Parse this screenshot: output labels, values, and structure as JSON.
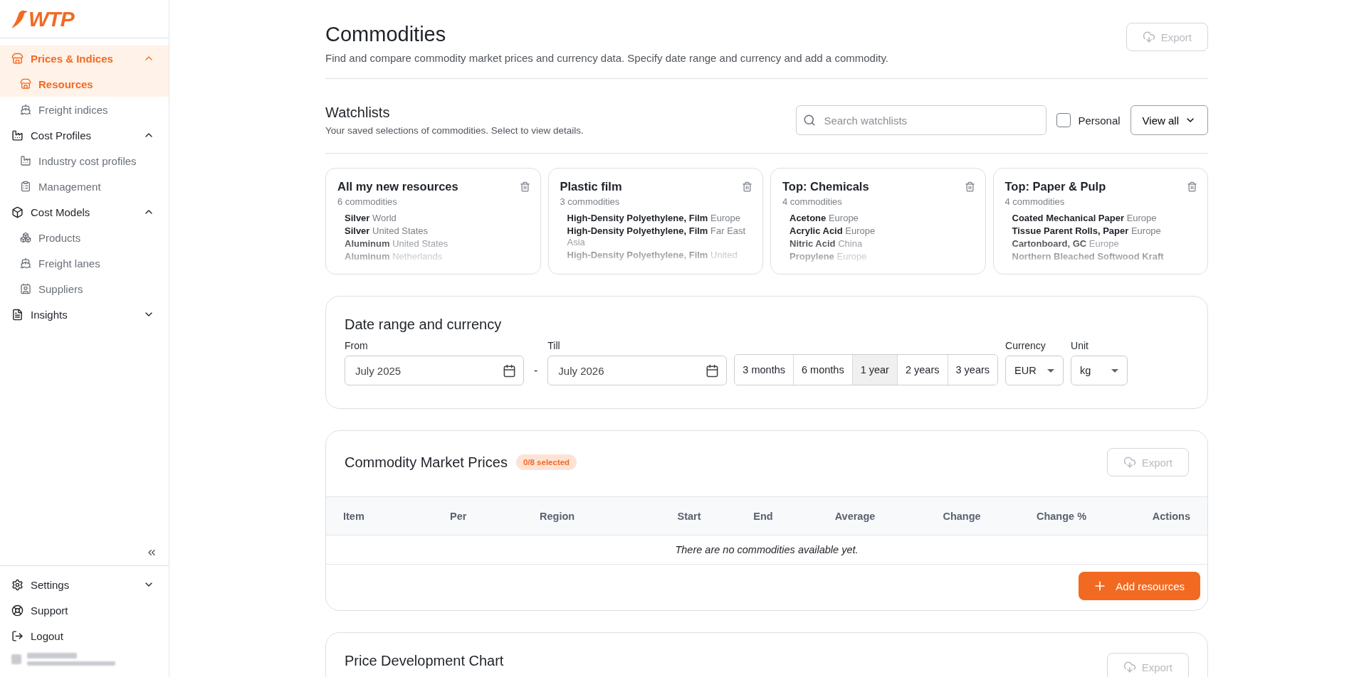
{
  "logo": {
    "text": "WTP"
  },
  "sidebar": {
    "groups": [
      {
        "label": "Prices & Indices",
        "selected": true,
        "expanded": true,
        "children": [
          {
            "label": "Resources",
            "selected": true
          },
          {
            "label": "Freight indices",
            "selected": false
          }
        ]
      },
      {
        "label": "Cost Profiles",
        "selected": false,
        "expanded": true,
        "children": [
          {
            "label": "Industry cost profiles",
            "selected": false
          },
          {
            "label": "Management",
            "selected": false
          }
        ]
      },
      {
        "label": "Cost Models",
        "selected": false,
        "expanded": true,
        "children": [
          {
            "label": "Products",
            "selected": false
          },
          {
            "label": "Freight lanes",
            "selected": false
          },
          {
            "label": "Suppliers",
            "selected": false
          }
        ]
      },
      {
        "label": "Insights",
        "selected": false,
        "expanded": false
      }
    ],
    "footer": [
      {
        "label": "Settings",
        "kind": "menu"
      },
      {
        "label": "Support",
        "kind": "link"
      },
      {
        "label": "Logout",
        "kind": "link"
      }
    ]
  },
  "header": {
    "title": "Commodities",
    "subtitle": "Find and compare commodity market prices and currency data. Specify date range and currency and add a commodity.",
    "export": {
      "label": "Export",
      "disabled": true
    }
  },
  "watchlists": {
    "title": "Watchlists",
    "subtitle": "Your saved selections of commodities. Select to view details.",
    "search": {
      "placeholder": "Search watchlists"
    },
    "personal": {
      "label": "Personal",
      "checked": false
    },
    "view_all": "View all",
    "cards": [
      {
        "title": "All my new resources",
        "count": "6 commodities",
        "items": [
          {
            "name": "Silver",
            "region": "World"
          },
          {
            "name": "Silver",
            "region": "United States"
          },
          {
            "name": "Aluminum",
            "region": "United States"
          },
          {
            "name": "Aluminum",
            "region": "Netherlands"
          }
        ]
      },
      {
        "title": "Plastic film",
        "count": "3 commodities",
        "items": [
          {
            "name": "High-Density Polyethylene, Film",
            "region": "Europe"
          },
          {
            "name": "High-Density Polyethylene, Film",
            "region": "Far East Asia"
          },
          {
            "name": "High-Density Polyethylene, Film",
            "region": "United"
          }
        ]
      },
      {
        "title": "Top: Chemicals",
        "count": "4 commodities",
        "items": [
          {
            "name": "Acetone",
            "region": "Europe"
          },
          {
            "name": "Acrylic Acid",
            "region": "Europe"
          },
          {
            "name": "Nitric Acid",
            "region": "China"
          },
          {
            "name": "Propylene",
            "region": "Europe"
          }
        ]
      },
      {
        "title": "Top: Paper & Pulp",
        "count": "4 commodities",
        "items": [
          {
            "name": "Coated Mechanical Paper",
            "region": "Europe"
          },
          {
            "name": "Tissue Parent Rolls, Paper",
            "region": "Europe"
          },
          {
            "name": "Cartonboard, GC",
            "region": "Europe"
          },
          {
            "name": "Northern Bleached Softwood Kraft"
          }
        ]
      }
    ]
  },
  "date_range": {
    "title": "Date range and currency",
    "from": {
      "label": "From",
      "value": "July 2025"
    },
    "separator": "-",
    "till": {
      "label": "Till",
      "value": "July 2026"
    },
    "presets": [
      {
        "label": "3 months",
        "selected": false
      },
      {
        "label": "6 months",
        "selected": false
      },
      {
        "label": "1 year",
        "selected": true
      },
      {
        "label": "2 years",
        "selected": false
      },
      {
        "label": "3 years",
        "selected": false
      }
    ],
    "currency": {
      "label": "Currency",
      "value": "EUR"
    },
    "unit": {
      "label": "Unit",
      "value": "kg"
    }
  },
  "market_prices": {
    "title": "Commodity Market Prices",
    "badge": "0/8 selected",
    "export": {
      "label": "Export",
      "disabled": true
    },
    "columns": [
      "Item",
      "Per",
      "Region",
      "Start",
      "End",
      "Average",
      "Change",
      "Change %",
      "Actions"
    ],
    "empty": "There are no commodities available yet.",
    "add_button": "Add resources"
  },
  "chart_card": {
    "title": "Price Development Chart",
    "export": {
      "label": "Export",
      "disabled": true
    }
  }
}
